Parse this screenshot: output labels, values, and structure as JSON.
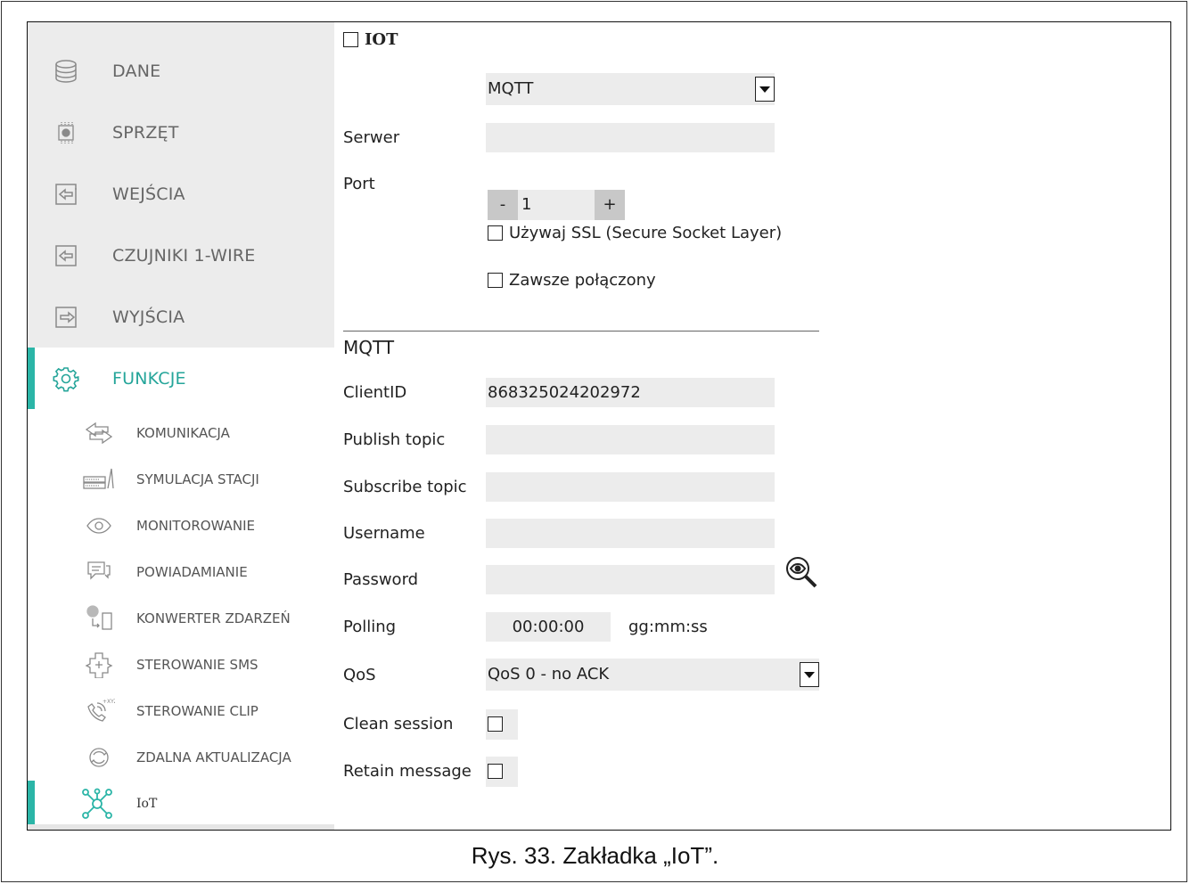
{
  "sidebar": {
    "main_items": [
      {
        "label": "DANE",
        "icon": "database-icon"
      },
      {
        "label": "SPRZĘT",
        "icon": "chip-icon"
      },
      {
        "label": "WEJŚCIA",
        "icon": "input-icon"
      },
      {
        "label": "CZUJNIKI 1-WIRE",
        "icon": "input-icon"
      },
      {
        "label": "WYJŚCIA",
        "icon": "output-icon"
      },
      {
        "label": "FUNKCJE",
        "icon": "gear-icon"
      }
    ],
    "sub_items": [
      {
        "label": "KOMUNIKACJA",
        "icon": "communication-arrows-icon"
      },
      {
        "label": "SYMULACJA STACJI",
        "icon": "station-icon"
      },
      {
        "label": "MONITOROWANIE",
        "icon": "eye-icon"
      },
      {
        "label": "POWIADAMIANIE",
        "icon": "chat-icon"
      },
      {
        "label": "KONWERTER ZDARZEŃ",
        "icon": "converter-icon"
      },
      {
        "label": "STEROWANIE SMS",
        "icon": "sms-icon"
      },
      {
        "label": "STEROWANIE CLIP",
        "icon": "phone-icon"
      },
      {
        "label": "ZDALNA AKTUALIZACJA",
        "icon": "refresh-icon"
      },
      {
        "label": "IoT",
        "icon": "network-nodes-icon"
      }
    ],
    "accent_color": "#2bb5a7"
  },
  "form": {
    "iot_label": "IOT",
    "protocol_select": "MQTT",
    "server_label": "Serwer",
    "server_value": "",
    "port_label": "Port",
    "port_minus": "-",
    "port_value": "1",
    "port_plus": "+",
    "ssl_label": "Używaj SSL (Secure Socket Layer)",
    "always_connected_label": "Zawsze połączony",
    "mqtt_section": "MQTT",
    "clientid_label": "ClientID",
    "clientid_value": "868325024202972",
    "publish_label": "Publish topic",
    "subscribe_label": "Subscribe topic",
    "username_label": "Username",
    "password_label": "Password",
    "polling_label": "Polling",
    "polling_value": "00:00:00",
    "polling_unit": "gg:mm:ss",
    "qos_label": "QoS",
    "qos_value": "QoS 0 - no ACK",
    "clean_session_label": "Clean session",
    "retain_label": "Retain message"
  },
  "caption": "Rys. 33. Zakładka „IoT”."
}
